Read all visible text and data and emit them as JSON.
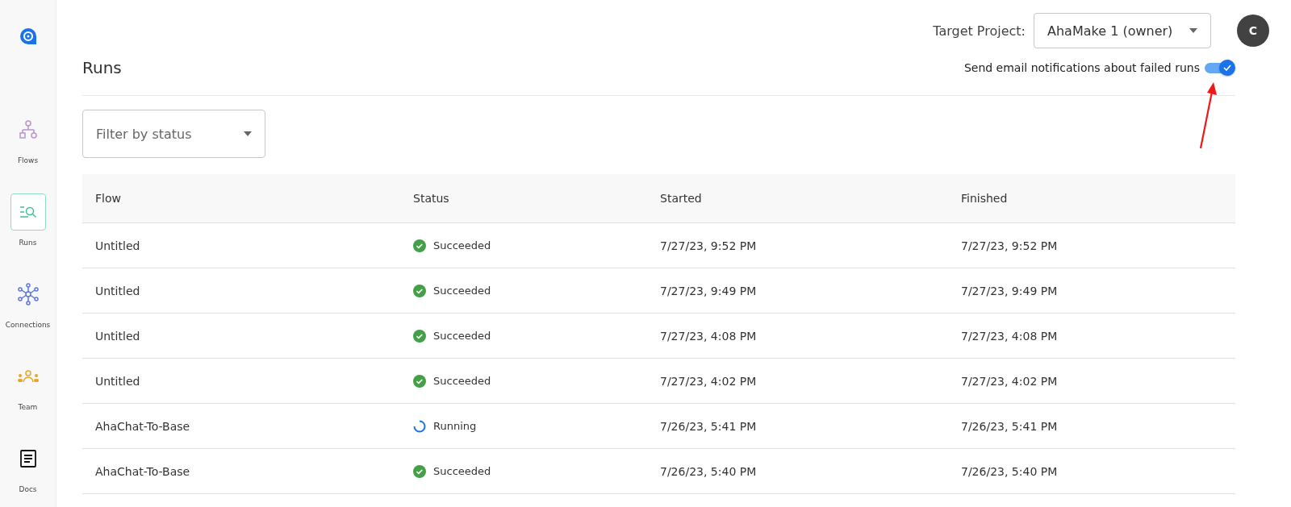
{
  "sidebar": {
    "items": [
      {
        "kind": "flows",
        "label": "Flows",
        "selected": false
      },
      {
        "kind": "runs",
        "label": "Runs",
        "selected": true
      },
      {
        "kind": "connections",
        "label": "Connections",
        "selected": false
      },
      {
        "kind": "team",
        "label": "Team",
        "selected": false
      },
      {
        "kind": "docs",
        "label": "Docs",
        "selected": false
      }
    ]
  },
  "header": {
    "project_label": "Target Project:",
    "project_value": "AhaMake 1 (owner)",
    "avatar": "C"
  },
  "page": {
    "title": "Runs",
    "notify_label": "Send email notifications about failed runs",
    "notify_on": true
  },
  "filter": {
    "placeholder": "Filter by status"
  },
  "table": {
    "columns": [
      "Flow",
      "Status",
      "Started",
      "Finished"
    ],
    "rows": [
      {
        "flow": "Untitled",
        "kind": "succeeded",
        "status_text": "Succeeded",
        "started": "7/27/23, 9:52 PM",
        "finished": "7/27/23, 9:52 PM"
      },
      {
        "flow": "Untitled",
        "kind": "succeeded",
        "status_text": "Succeeded",
        "started": "7/27/23, 9:49 PM",
        "finished": "7/27/23, 9:49 PM"
      },
      {
        "flow": "Untitled",
        "kind": "succeeded",
        "status_text": "Succeeded",
        "started": "7/27/23, 4:08 PM",
        "finished": "7/27/23, 4:08 PM"
      },
      {
        "flow": "Untitled",
        "kind": "succeeded",
        "status_text": "Succeeded",
        "started": "7/27/23, 4:02 PM",
        "finished": "7/27/23, 4:02 PM"
      },
      {
        "flow": "AhaChat-To-Base",
        "kind": "running",
        "status_text": "Running",
        "started": "7/26/23, 5:41 PM",
        "finished": "7/26/23, 5:41 PM"
      },
      {
        "flow": "AhaChat-To-Base",
        "kind": "succeeded",
        "status_text": "Succeeded",
        "started": "7/26/23, 5:40 PM",
        "finished": "7/26/23, 5:40 PM"
      }
    ]
  }
}
